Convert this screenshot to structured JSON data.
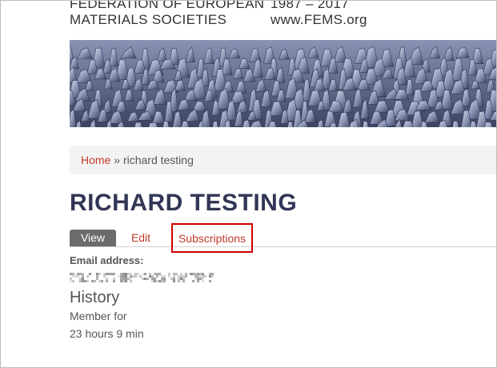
{
  "header": {
    "org_line1": "FEDERATION OF EUROPEAN",
    "org_line2": "MATERIALS SOCIETIES",
    "years": "1987 – 2017",
    "website": "www.FEMS.org"
  },
  "breadcrumb": {
    "home": "Home",
    "separator": "»",
    "current": "richard testing"
  },
  "page": {
    "title": "RICHARD TESTING"
  },
  "tabs": {
    "view": "View",
    "edit": "Edit",
    "subscriptions": "Subscriptions"
  },
  "profile": {
    "email_label": "Email address:",
    "history_title": "History",
    "member_label": "Member for",
    "member_value": "23 hours 9 min"
  },
  "colors": {
    "link": "#c0392b",
    "title": "#313656",
    "tab_active_bg": "#6b6b6b",
    "highlight_box": "#d00000"
  }
}
